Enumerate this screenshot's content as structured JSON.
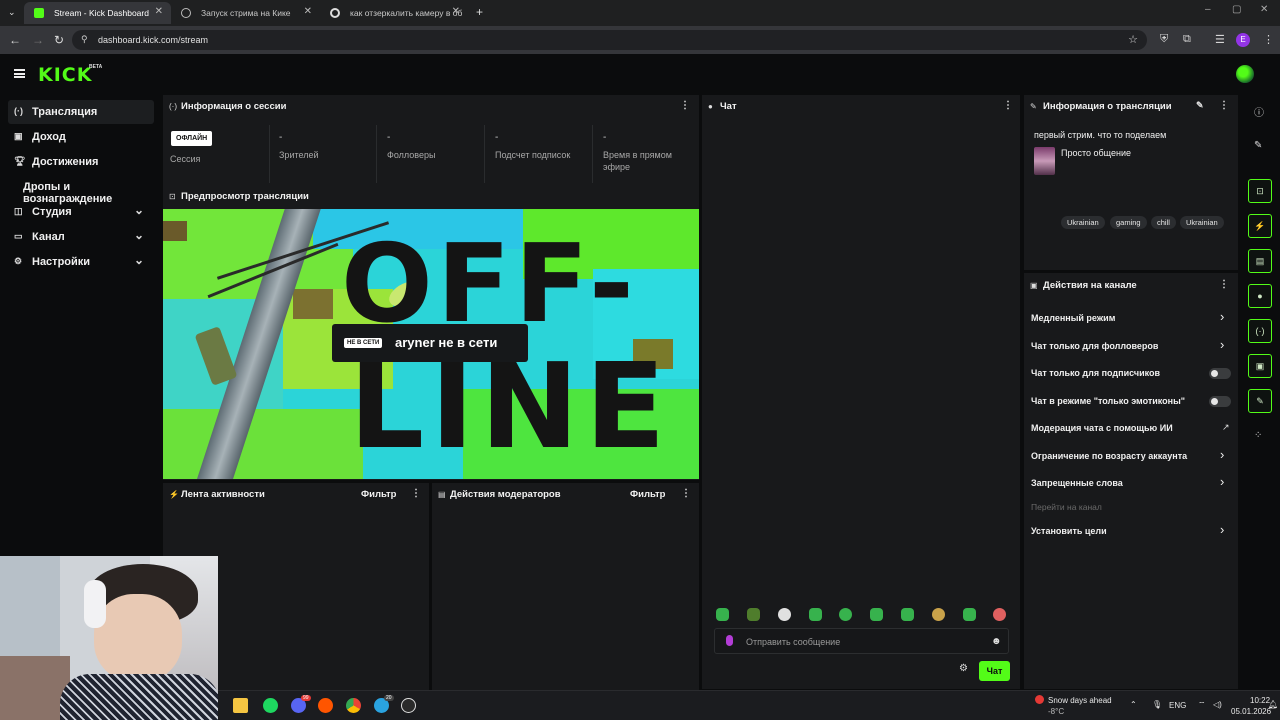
{
  "browser": {
    "tabs": [
      {
        "title": "Stream - Kick Dashboard",
        "active": true
      },
      {
        "title": "Запуск стрима на Кике",
        "active": false
      },
      {
        "title": "как отзеркалить камеру в об",
        "active": false
      }
    ],
    "url": "dashboard.kick.com/stream",
    "profile_initial": "E"
  },
  "brand": {
    "logo": "KICK",
    "beta": "BETA",
    "accent": "#53fc18"
  },
  "sidebar": {
    "items": [
      {
        "label": "Трансляция",
        "icon": "broadcast-icon"
      },
      {
        "label": "Доход",
        "icon": "wallet-icon"
      },
      {
        "label": "Достижения",
        "icon": "trophy-icon"
      },
      {
        "label": "Дропы и вознаграждение",
        "icon": ""
      },
      {
        "label": "Студия",
        "icon": "studio-icon"
      },
      {
        "label": "Канал",
        "icon": "channel-icon"
      },
      {
        "label": "Настройки",
        "icon": "gear-icon"
      }
    ]
  },
  "session": {
    "title": "Информация о сессии",
    "status_badge": "ОФЛАЙН",
    "stats": [
      {
        "value": "",
        "label": "Сессия"
      },
      {
        "value": "-",
        "label": "Зрителей"
      },
      {
        "value": "-",
        "label": "Фолловеры"
      },
      {
        "value": "-",
        "label": "Подсчет подписок"
      },
      {
        "value": "-",
        "label": "Время в прямом эфире"
      }
    ]
  },
  "preview": {
    "title": "Предпросмотр трансляции",
    "offline_art_line1": "OFF-",
    "offline_art_line2": "LINE",
    "offline_badge": "НЕ В СЕТИ",
    "offline_text": "aryner не в сети"
  },
  "activity": {
    "title": "Лента активности",
    "filter": "Фильтр"
  },
  "mod_actions": {
    "title": "Действия модераторов",
    "filter": "Фильтр"
  },
  "chat": {
    "title": "Чат",
    "placeholder": "Отправить сообщение",
    "send_label": "Чат"
  },
  "stream_info": {
    "title": "Информация о трансляции",
    "stream_title": "первый стрим. что то поделаем",
    "category": "Просто общение",
    "tags": [
      "Ukrainian",
      "gaming",
      "chill",
      "Ukrainian"
    ]
  },
  "channel_actions": {
    "title": "Действия на канале",
    "items": [
      {
        "label": "Медленный режим",
        "control": "chevron"
      },
      {
        "label": "Чат только для фолловеров",
        "control": "chevron"
      },
      {
        "label": "Чат только для подписчиков",
        "control": "toggle",
        "enabled": false
      },
      {
        "label": "Чат в режиме \"только эмотиконы\"",
        "control": "toggle",
        "enabled": false
      },
      {
        "label": "Модерация чата с помощью ИИ",
        "control": "external"
      },
      {
        "label": "Ограничение по возрасту аккаунта",
        "control": "chevron"
      },
      {
        "label": "Запрещенные слова",
        "control": "chevron"
      }
    ],
    "goto_channel": "Перейти на канал",
    "set_goals": "Установить цели"
  },
  "taskbar": {
    "weather_text": "Snow days ahead",
    "temperature": "-8°C",
    "language": "ENG",
    "time": "10:22",
    "date": "05.01.2026",
    "telegram_badge": "20",
    "discord_badge": "99"
  }
}
